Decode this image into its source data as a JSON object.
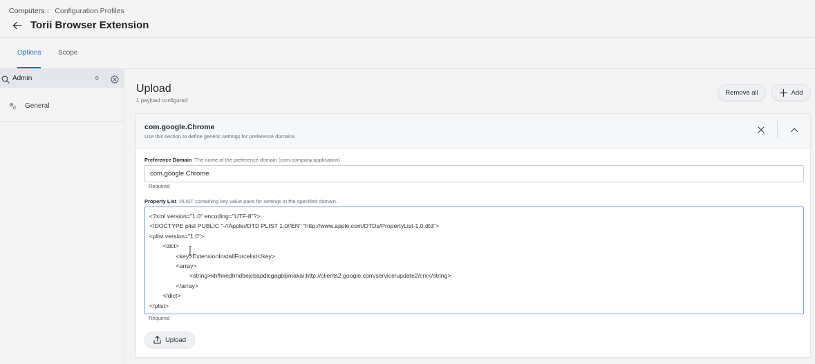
{
  "header": {
    "breadcrumb_root": "Computers",
    "breadcrumb_sep": ":",
    "breadcrumb_current": "Configuration Profiles",
    "title": "Torii Browser Extension"
  },
  "tabs": [
    {
      "label": "Options",
      "active": true
    },
    {
      "label": "Scope",
      "active": false
    }
  ],
  "sidebar": {
    "search_value": "Admin",
    "search_count": "0",
    "items": [
      {
        "label": "General",
        "icon": "gear-icon"
      }
    ]
  },
  "main": {
    "title": "Upload",
    "subtitle": "1 payload configured",
    "remove_all_label": "Remove all",
    "add_label": "Add"
  },
  "payload": {
    "title": "com.google.Chrome",
    "description": "Use this section to define generic settings for preference domains",
    "domain_label": "Preference Domain",
    "domain_hint": "The name of the preference domain (com.company.application)",
    "domain_value": "com.google.Chrome",
    "domain_required": "Required",
    "plist_label": "Property List",
    "plist_hint": "PLIST containing key value pairs for settings in the specified domain.",
    "plist_lines": [
      "<?xml version=\"1.0\" encoding=\"UTF-8\"?>",
      "<!DOCTYPE plist PUBLIC \"-//Apple//DTD PLIST 1.0//EN\" \"http://www.apple.com/DTDs/PropertyList-1.0.dtd\">",
      "<plist version=\"1.0\">",
      "        <dict>",
      "                <key>ExtensionInstallForcelist</key>",
      "                <array>",
      "                        <string>khfhkedhhdbejcbapdlcgagbljimakai;http://clients2.google.com/service/update2/crx</string>",
      "                </array>",
      "        </dict>",
      "</plist>"
    ],
    "plist_required": "Required",
    "upload_label": "Upload"
  },
  "colors": {
    "accent": "#1b6ec2",
    "focus_border": "#6a9ed4",
    "background": "#f4f4f5"
  }
}
